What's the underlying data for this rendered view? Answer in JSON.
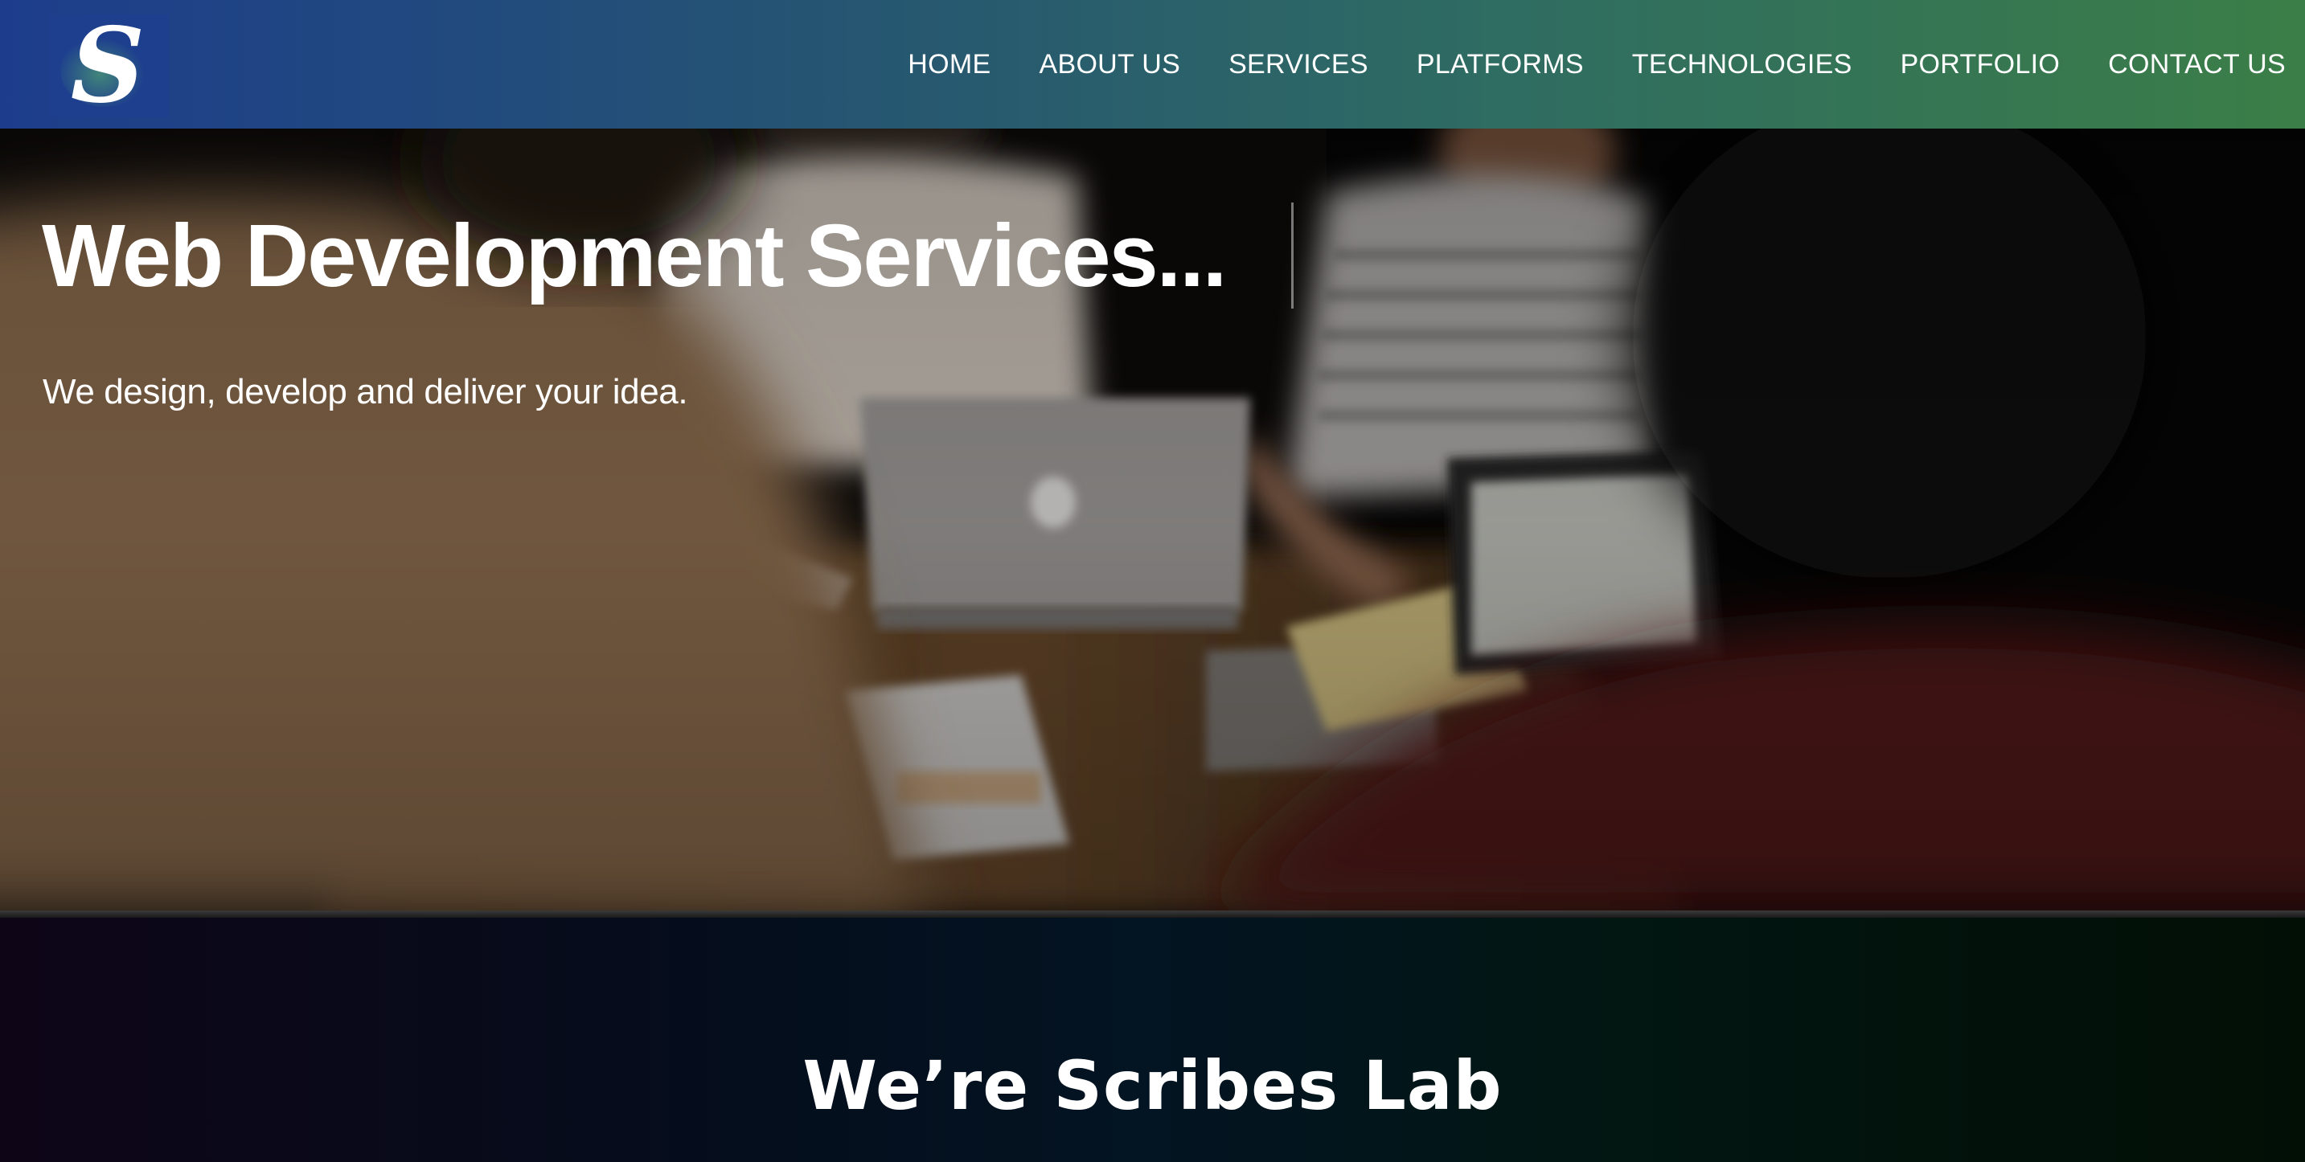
{
  "header": {
    "logo_letter": "S",
    "nav_items": [
      "HOME",
      "ABOUT US",
      "SERVICES",
      "PLATFORMS",
      "TECHNOLOGIES",
      "PORTFOLIO",
      "CONTACT US"
    ]
  },
  "hero": {
    "title": "Web Development Services...",
    "subtitle": "We design, develop and deliver your idea."
  },
  "intro": {
    "title": "We’re Scribes Lab"
  },
  "colors": {
    "header_start": "#1d3d8c",
    "header_end": "#3b7e47",
    "text": "#ffffff"
  }
}
